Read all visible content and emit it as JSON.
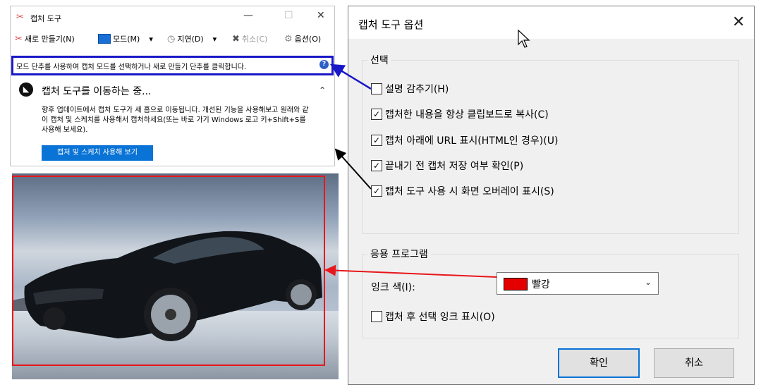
{
  "snip": {
    "title": "캡처 도구",
    "toolbar": {
      "new": "새로 만들기(N)",
      "mode": "모드(M)",
      "delay": "지연(D)",
      "cancel": "취소(C)",
      "options": "옵션(O)"
    },
    "info": "모드 단추를 사용하여 캡처 모드를 선택하거나 새로 만들기 단추를 클릭합니다.",
    "move_title": "캡처 도구를 이동하는 중...",
    "move_desc": "향후 업데이트에서 캡처 도구가 새 홈으로 이동됩니다. 개선된 기능을 사용해보고 원래와 같이 캡처 및 스케치를 사용해서 캡처하세요(또는 바로 가기 Windows 로고 키+Shift+S를 사용해 보세요).",
    "try_button": "캡처 및 스케치 사용해 보기"
  },
  "dialog": {
    "title": "캡처 도구 옵션",
    "section_select": "선택",
    "options": [
      {
        "label": "설명 감추기(H)",
        "checked": false
      },
      {
        "label": "캡처한 내용을 항상 클립보드로 복사(C)",
        "checked": true
      },
      {
        "label": "캡처 아래에 URL 표시(HTML인 경우)(U)",
        "checked": true
      },
      {
        "label": "끝내기 전 캡처 저장 여부 확인(P)",
        "checked": true
      },
      {
        "label": "캡처 도구 사용 시 화면 오버레이 표시(S)",
        "checked": true
      }
    ],
    "section_app": "응용 프로그램",
    "ink_color_label": "잉크 색(I):",
    "ink_color_value": "빨강",
    "ink_color_hex": "#e50000",
    "show_ink": {
      "label": "캡처 후 선택 잉크 표시(O)",
      "checked": false
    },
    "ok": "확인",
    "cancel": "취소"
  },
  "colors": {
    "info_border": "#1a17c8",
    "snip_border": "#e8161b",
    "accent": "#0a73d6"
  }
}
